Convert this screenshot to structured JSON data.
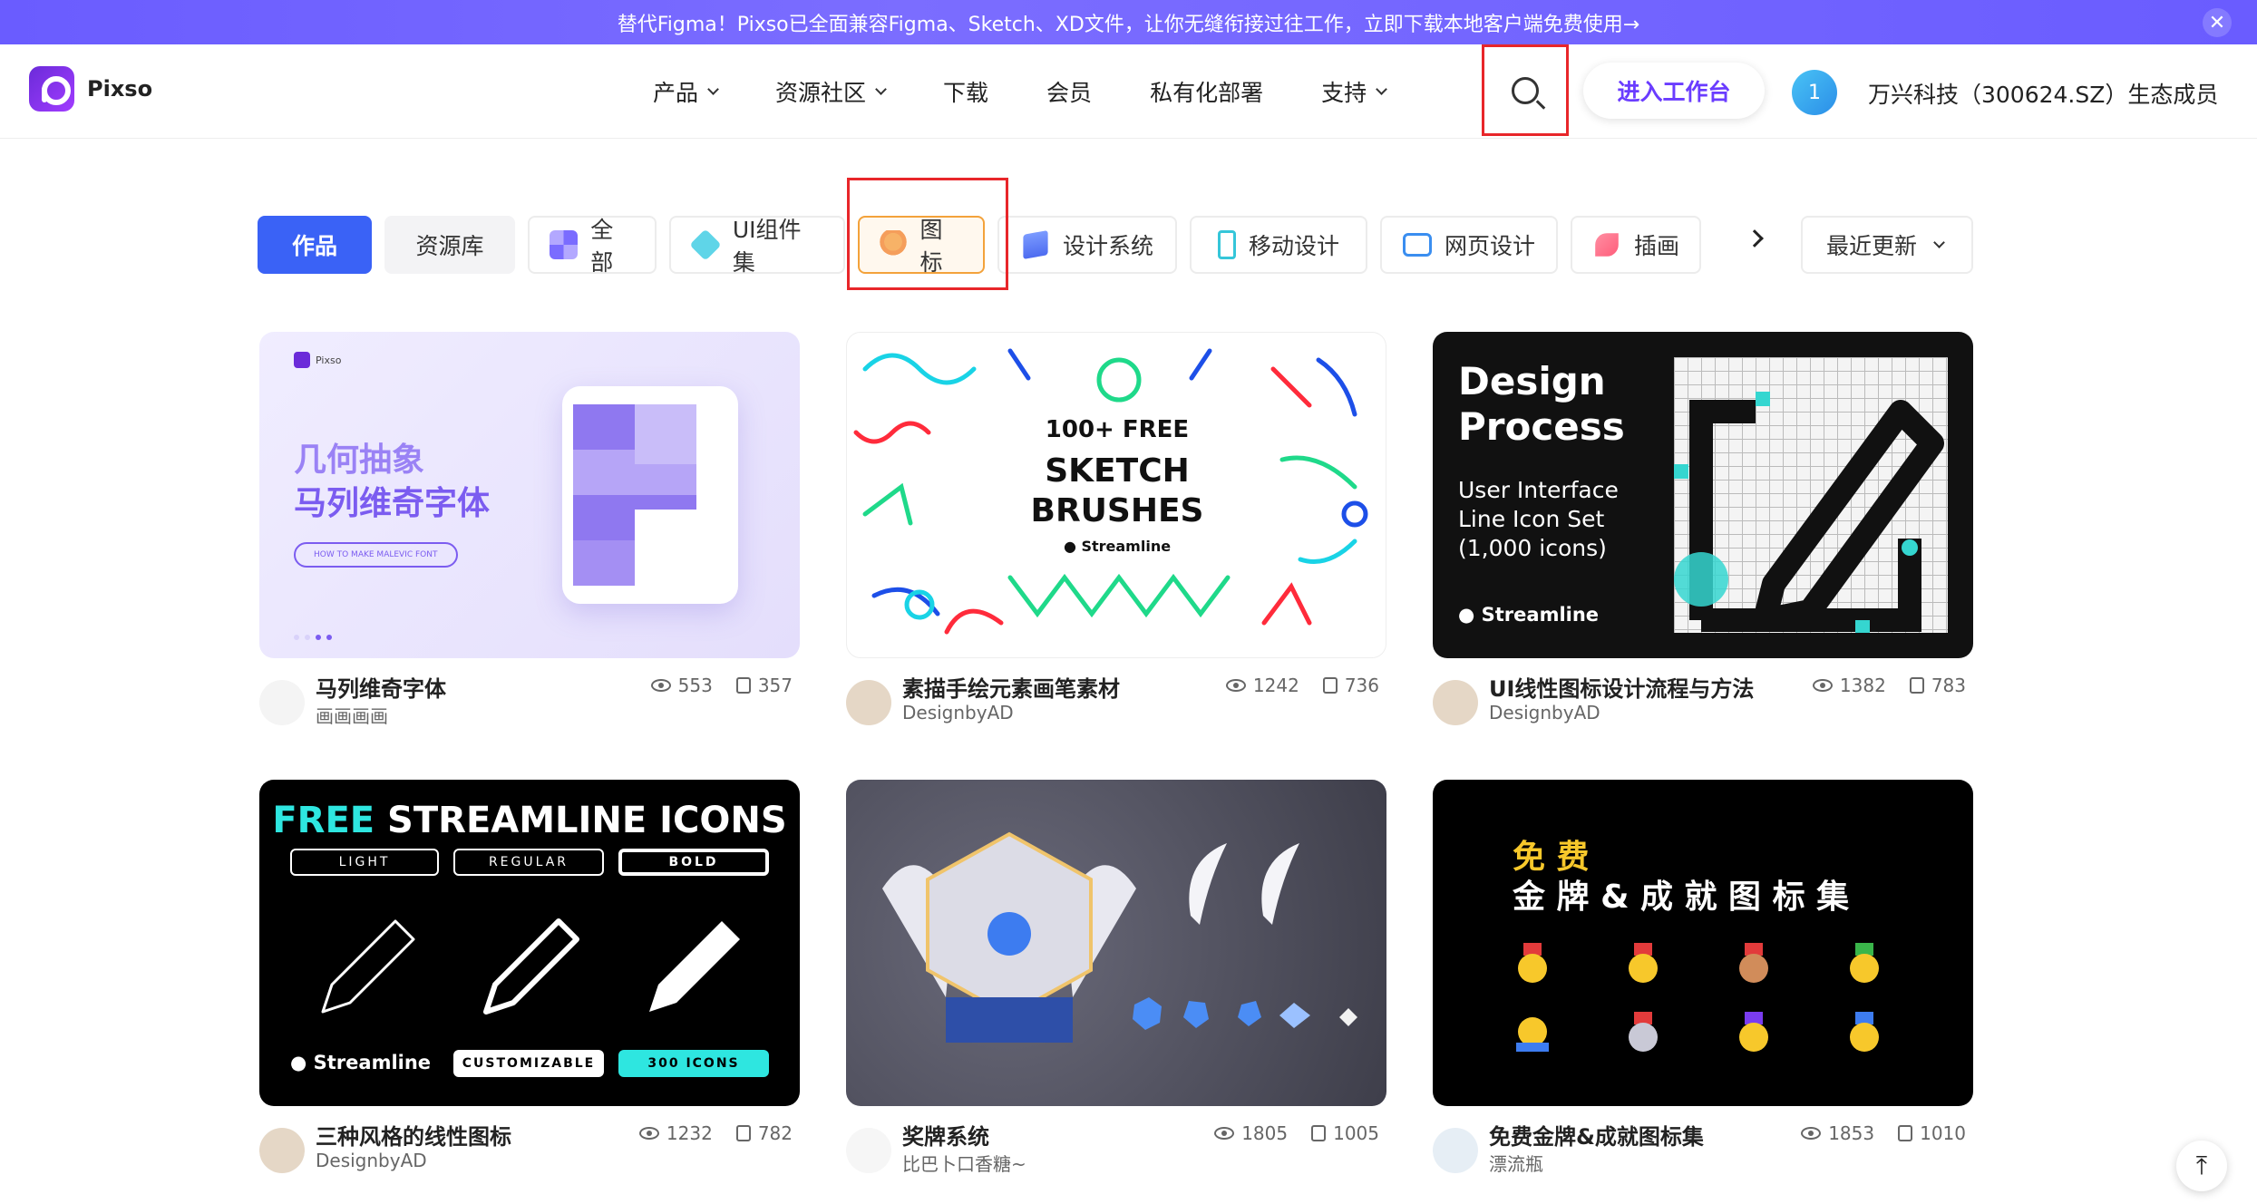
{
  "banner": {
    "text": "替代Figma！Pixso已全面兼容Figma、Sketch、XD文件，让你无缝衔接过往工作，立即下载本地客户端免费使用→",
    "close": "✕"
  },
  "header": {
    "logo_text": "Pixso",
    "nav": [
      {
        "label": "产品",
        "dropdown": true
      },
      {
        "label": "资源社区",
        "dropdown": true
      },
      {
        "label": "下载",
        "dropdown": false
      },
      {
        "label": "会员",
        "dropdown": false
      },
      {
        "label": "私有化部署",
        "dropdown": false
      },
      {
        "label": "支持",
        "dropdown": true
      }
    ],
    "workspace_button": "进入工作台",
    "avatar_number": "1",
    "company": "万兴科技（300624.SZ）生态成员"
  },
  "filters": {
    "works": "作品",
    "library": "资源库",
    "categories": [
      "全部",
      "UI组件集",
      "图标",
      "设计系统",
      "移动设计",
      "网页设计",
      "插画"
    ],
    "active": "图标",
    "sort": "最近更新"
  },
  "cards": [
    {
      "title": "马列维奇字体",
      "author": "画画画画",
      "views": "553",
      "copies": "357",
      "thumb": {
        "headline1": "几何抽象",
        "headline2": "马列维奇字体",
        "pill": "HOW TO MAKE MALEVIC FONT",
        "brand": "Pixso"
      }
    },
    {
      "title": "素描手绘元素画笔素材",
      "author": "DesignbyAD",
      "views": "1242",
      "copies": "736",
      "thumb": {
        "line1": "100+ FREE",
        "line2": "SKETCH",
        "line3": "BRUSHES",
        "brand": "Streamline"
      }
    },
    {
      "title": "UI线性图标设计流程与方法",
      "author": "DesignbyAD",
      "views": "1382",
      "copies": "783",
      "thumb": {
        "line1": "Design",
        "line2": "Process",
        "sub1": "User Interface",
        "sub2": "Line Icon Set",
        "sub3": "(1,000 icons)",
        "brand": "Streamline"
      }
    },
    {
      "title": "三种风格的线性图标",
      "author": "DesignbyAD",
      "views": "1232",
      "copies": "782",
      "thumb": {
        "free": "FREE",
        "rest": "STREAMLINE ICONS",
        "styles": [
          "LIGHT",
          "REGULAR",
          "BOLD"
        ],
        "brand": "Streamline",
        "tag1": "CUSTOMIZABLE",
        "tag2": "300 ICONS"
      }
    },
    {
      "title": "奖牌系统",
      "author": "比巴卜口香糖~",
      "views": "1805",
      "copies": "1005",
      "thumb": {}
    },
    {
      "title": "免费金牌&成就图标集",
      "author": "漂流瓶",
      "views": "1853",
      "copies": "1010",
      "thumb": {
        "line1": "免 费",
        "line2": "金 牌 & 成 就 图 标 集"
      }
    }
  ],
  "colors": {
    "accent": "#3a62f6",
    "banner": "#6a5cff",
    "highlight": "#e8262a"
  }
}
